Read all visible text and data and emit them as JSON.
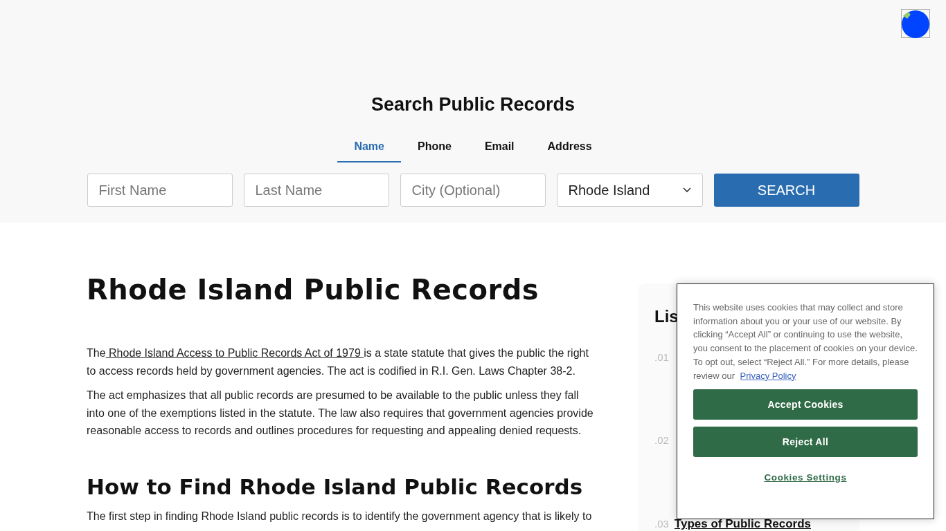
{
  "header": {
    "title": "Search Public Records",
    "tabs": [
      {
        "label": "Name",
        "selected": true
      },
      {
        "label": "Phone",
        "selected": false
      },
      {
        "label": "Email",
        "selected": false
      },
      {
        "label": "Address",
        "selected": false
      }
    ],
    "fields": [
      {
        "placeholder": "First Name"
      },
      {
        "placeholder": "Last Name"
      },
      {
        "placeholder": "City (Optional)"
      }
    ],
    "state_select": {
      "value": "Rhode Island"
    },
    "search_button": "SEARCH"
  },
  "article": {
    "title": "Rhode Island Public Records",
    "paragraph_1": {
      "before": "The",
      "link": " Rhode Island Access to Public Records Act of 1979 ",
      "after": "is a state statute that gives the public the right to access records held by government agencies. The act is codified in R.I. Gen. Laws Chapter 38-2."
    },
    "paragraph_2": "The act emphasizes that all public records are presumed to be available to the public unless they fall into one of the exemptions listed in the statute. The law also requires that government agencies provide reasonable access to records and outlines procedures for requesting and appealing denied requests.",
    "heading_2": "How to Find Rhode Island Public Records",
    "paragraph_3": "The first step in finding Rhode Island public records is to identify the government agency that is likely to"
  },
  "sidebar": {
    "title": "Lis",
    "items": [
      {
        "number": ".01"
      },
      {
        "number": ".02"
      },
      {
        "number": ".03",
        "label": "Types of Public Records"
      }
    ]
  },
  "cookie_banner": {
    "text": "This website uses cookies that may collect and store information about you or your use of our website. By clicking “Accept All” or continuing to use the website, you consent to the placement of cookies on your device. To opt out, select “Reject All.” For more details, please review our ",
    "link": "Privacy Policy",
    "buttons": [
      "Accept Cookies",
      "Reject All"
    ],
    "settings_link": "Cookies Settings"
  }
}
